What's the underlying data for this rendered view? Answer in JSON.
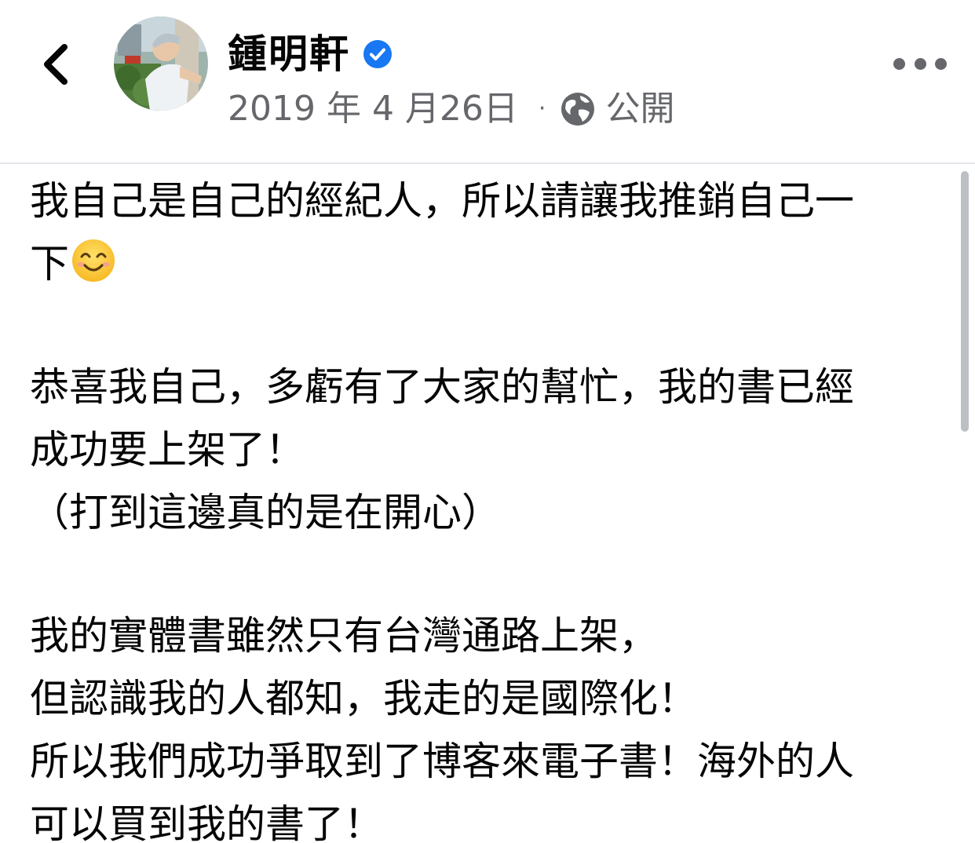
{
  "header": {
    "back_icon": "chevron-left-icon",
    "name": "鍾明軒",
    "verified_icon": "verified-badge-icon",
    "date": "2019 年 4 月26日",
    "separator": "·",
    "privacy_icon": "globe-icon",
    "privacy": "公開",
    "more_icon": "more-horizontal-icon"
  },
  "post": {
    "lines": [
      "我自己是自己的經紀人，所以請讓我推銷自己一",
      "下",
      "恭喜我自己，多虧有了大家的幫忙，我的書已經",
      "成功要上架了！",
      "（打到這邊真的是在開心）",
      "我的實體書雖然只有台灣通路上架，",
      "但認識我的人都知，我走的是國際化！",
      "所以我們成功爭取到了博客來電子書！海外的人",
      "可以買到我的書了！"
    ],
    "emoji": "smiling-face-icon"
  },
  "colors": {
    "text": "#050505",
    "secondary": "#65676b",
    "verified": "#1877f2",
    "divider": "#e4e6eb"
  }
}
